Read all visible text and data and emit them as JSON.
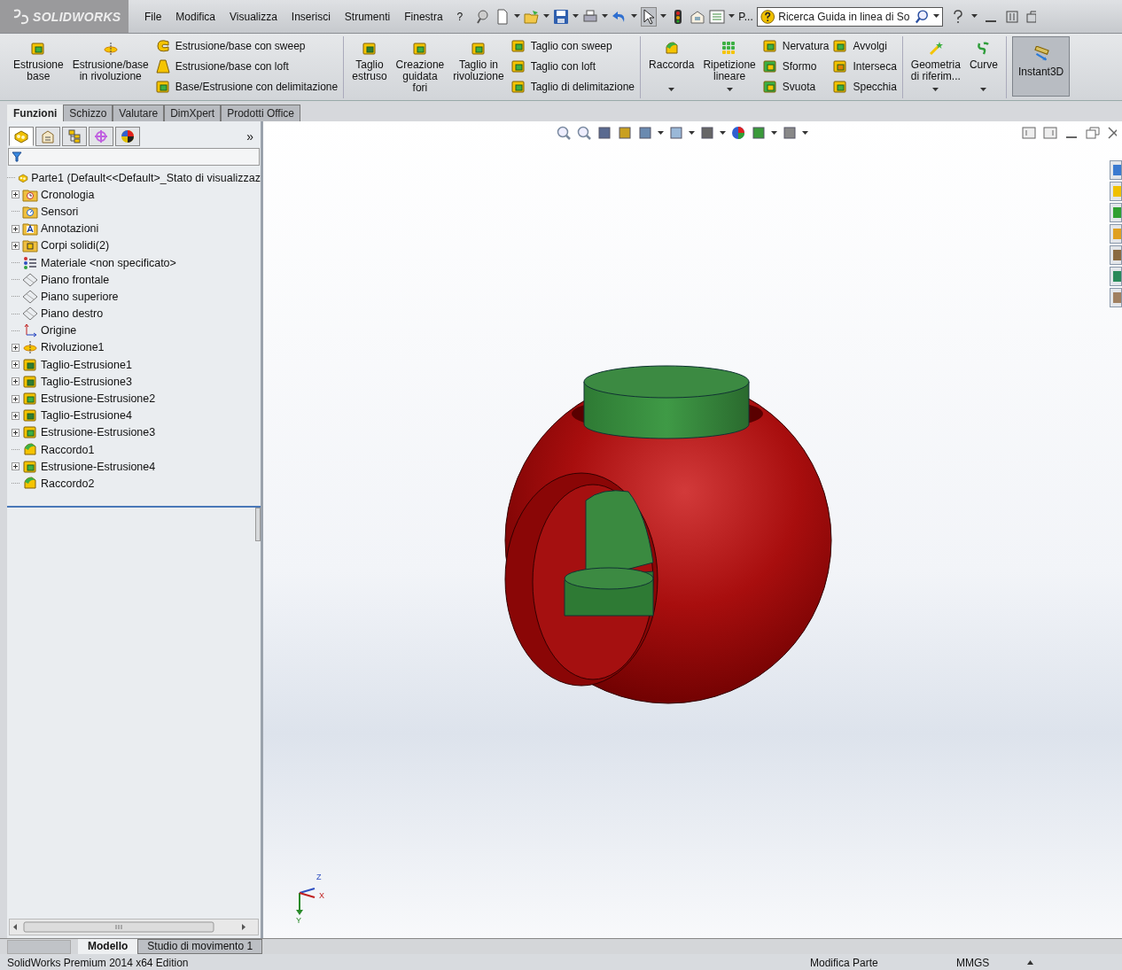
{
  "title_bar": {
    "logo": "SOLIDWORKS",
    "menu": [
      "File",
      "Modifica",
      "Visualizza",
      "Inserisci",
      "Strumenti",
      "Finestra",
      "?"
    ],
    "overflow": "P...",
    "search": {
      "placeholder": "Ricerca Guida in linea di So"
    }
  },
  "ribbon": {
    "sections": [
      {
        "items": [
          {
            "kind": "large",
            "label": "Estrusione\nbase",
            "dropdown": false
          },
          {
            "kind": "large",
            "label": "Estrusione/base\nin rivoluzione",
            "dropdown": false
          },
          {
            "kind": "stack",
            "rows": [
              {
                "label": "Estrusione/base con sweep"
              },
              {
                "label": "Estrusione/base con loft"
              },
              {
                "label": "Base/Estrusione con delimitazione"
              }
            ]
          }
        ]
      },
      {
        "items": [
          {
            "kind": "large",
            "label": "Taglio\nestruso",
            "dropdown": false
          },
          {
            "kind": "large",
            "label": "Creazione\nguidata\nfori",
            "dropdown": false
          },
          {
            "kind": "large",
            "label": "Taglio in\nrivoluzione",
            "dropdown": false
          },
          {
            "kind": "stack",
            "rows": [
              {
                "label": "Taglio con sweep"
              },
              {
                "label": "Taglio con loft"
              },
              {
                "label": "Taglio di delimitazione"
              }
            ]
          }
        ]
      },
      {
        "items": [
          {
            "kind": "large",
            "label": "Raccorda",
            "dropdown": true
          },
          {
            "kind": "large",
            "label": "Ripetizione\nlineare",
            "dropdown": true
          },
          {
            "kind": "stack",
            "rows": [
              {
                "label": "Nervatura"
              },
              {
                "label": "Sformo"
              },
              {
                "label": "Svuota"
              }
            ]
          },
          {
            "kind": "stack",
            "rows": [
              {
                "label": "Avvolgi"
              },
              {
                "label": "Interseca"
              },
              {
                "label": "Specchia"
              }
            ]
          }
        ]
      },
      {
        "items": [
          {
            "kind": "large",
            "label": "Geometria\ndi riferim...",
            "dropdown": true
          },
          {
            "kind": "large",
            "label": "Curve",
            "dropdown": true
          }
        ]
      },
      {
        "items": [
          {
            "kind": "toggle",
            "label": "Instant3D",
            "on": true
          }
        ]
      }
    ]
  },
  "tabs": [
    {
      "label": "Funzioni",
      "selected": true
    },
    {
      "label": "Schizzo",
      "selected": false
    },
    {
      "label": "Valutare",
      "selected": false
    },
    {
      "label": "DimXpert",
      "selected": false
    },
    {
      "label": "Prodotti Office",
      "selected": false
    }
  ],
  "panel": {
    "tabs": [
      {
        "kind": "feature",
        "selected": true
      },
      {
        "kind": "property",
        "selected": false
      },
      {
        "kind": "config",
        "selected": false
      },
      {
        "kind": "dimxpert",
        "selected": false
      },
      {
        "kind": "display",
        "selected": false
      }
    ],
    "more": "»",
    "tree": [
      {
        "kind": "part",
        "label": "Parte1  (Default<<Default>_Stato di visualizzaz",
        "collapsed": false,
        "children": [
          {
            "kind": "history",
            "label": "Cronologia",
            "collapsed": true
          },
          {
            "kind": "sensor",
            "label": "Sensori",
            "collapsed": false
          },
          {
            "kind": "annotation",
            "label": "Annotazioni",
            "collapsed": true
          },
          {
            "kind": "solid",
            "label": "Corpi solidi(2)",
            "collapsed": true
          },
          {
            "kind": "material",
            "label": "Materiale <non specificato>",
            "collapsed": false
          },
          {
            "kind": "plane",
            "label": "Piano frontale",
            "collapsed": false
          },
          {
            "kind": "plane",
            "label": "Piano superiore",
            "collapsed": false
          },
          {
            "kind": "plane",
            "label": "Piano destro",
            "collapsed": false
          },
          {
            "kind": "origin",
            "label": "Origine",
            "collapsed": false
          },
          {
            "kind": "revolve",
            "label": "Rivoluzione1",
            "collapsed": true
          },
          {
            "kind": "cut",
            "label": "Taglio-Estrusione1",
            "collapsed": true
          },
          {
            "kind": "cut",
            "label": "Taglio-Estrusione3",
            "collapsed": true
          },
          {
            "kind": "extrude",
            "label": "Estrusione-Estrusione2",
            "collapsed": true
          },
          {
            "kind": "cut",
            "label": "Taglio-Estrusione4",
            "collapsed": true
          },
          {
            "kind": "extrude",
            "label": "Estrusione-Estrusione3",
            "collapsed": true
          },
          {
            "kind": "fillet",
            "label": "Raccordo1",
            "collapsed": false
          },
          {
            "kind": "extrude",
            "label": "Estrusione-Estrusione4",
            "collapsed": true
          },
          {
            "kind": "fillet",
            "label": "Raccordo2",
            "collapsed": false
          }
        ]
      }
    ]
  },
  "viewport": {
    "triad": {
      "x": "X",
      "y": "Y",
      "z": "Z"
    }
  },
  "bottom_tabs": [
    {
      "label": "Modello",
      "selected": true
    },
    {
      "label": "Studio di movimento 1",
      "selected": false
    }
  ],
  "status_bar": {
    "edition": "SolidWorks Premium 2014 x64 Edition",
    "mode": "Modifica Parte",
    "units": "MMGS"
  }
}
